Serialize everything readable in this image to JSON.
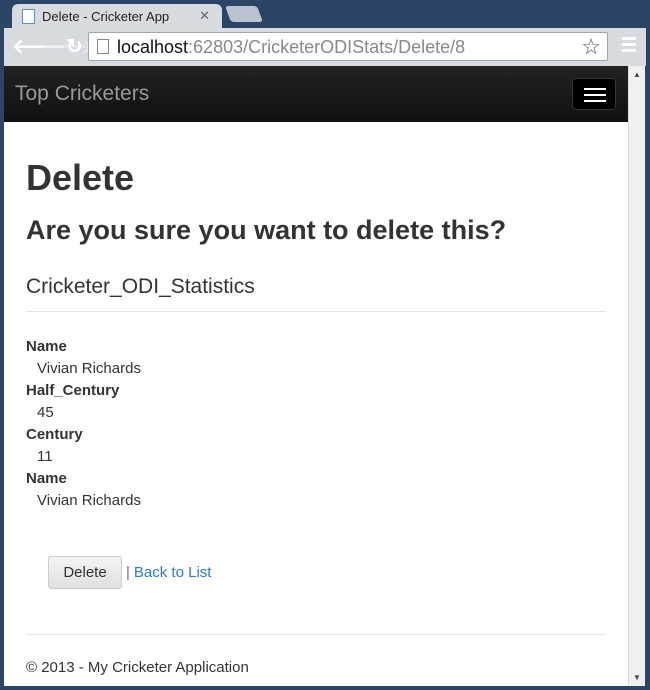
{
  "browser": {
    "tab_title": "Delete - Cricketer App",
    "url_host": "localhost",
    "url_rest": ":62803/CricketerODIStats/Delete/8"
  },
  "navbar": {
    "brand": "Top Cricketers"
  },
  "page": {
    "title": "Delete",
    "question": "Are you sure you want to delete this?",
    "entity": "Cricketer_ODI_Statistics",
    "fields": [
      {
        "label": "Name",
        "value": "Vivian Richards"
      },
      {
        "label": "Half_Century",
        "value": "45"
      },
      {
        "label": "Century",
        "value": "11"
      },
      {
        "label": "Name",
        "value": "Vivian Richards"
      }
    ],
    "delete_label": "Delete",
    "separator": "|",
    "back_label": "Back to List"
  },
  "footer": {
    "text": "© 2013 - My Cricketer Application"
  }
}
